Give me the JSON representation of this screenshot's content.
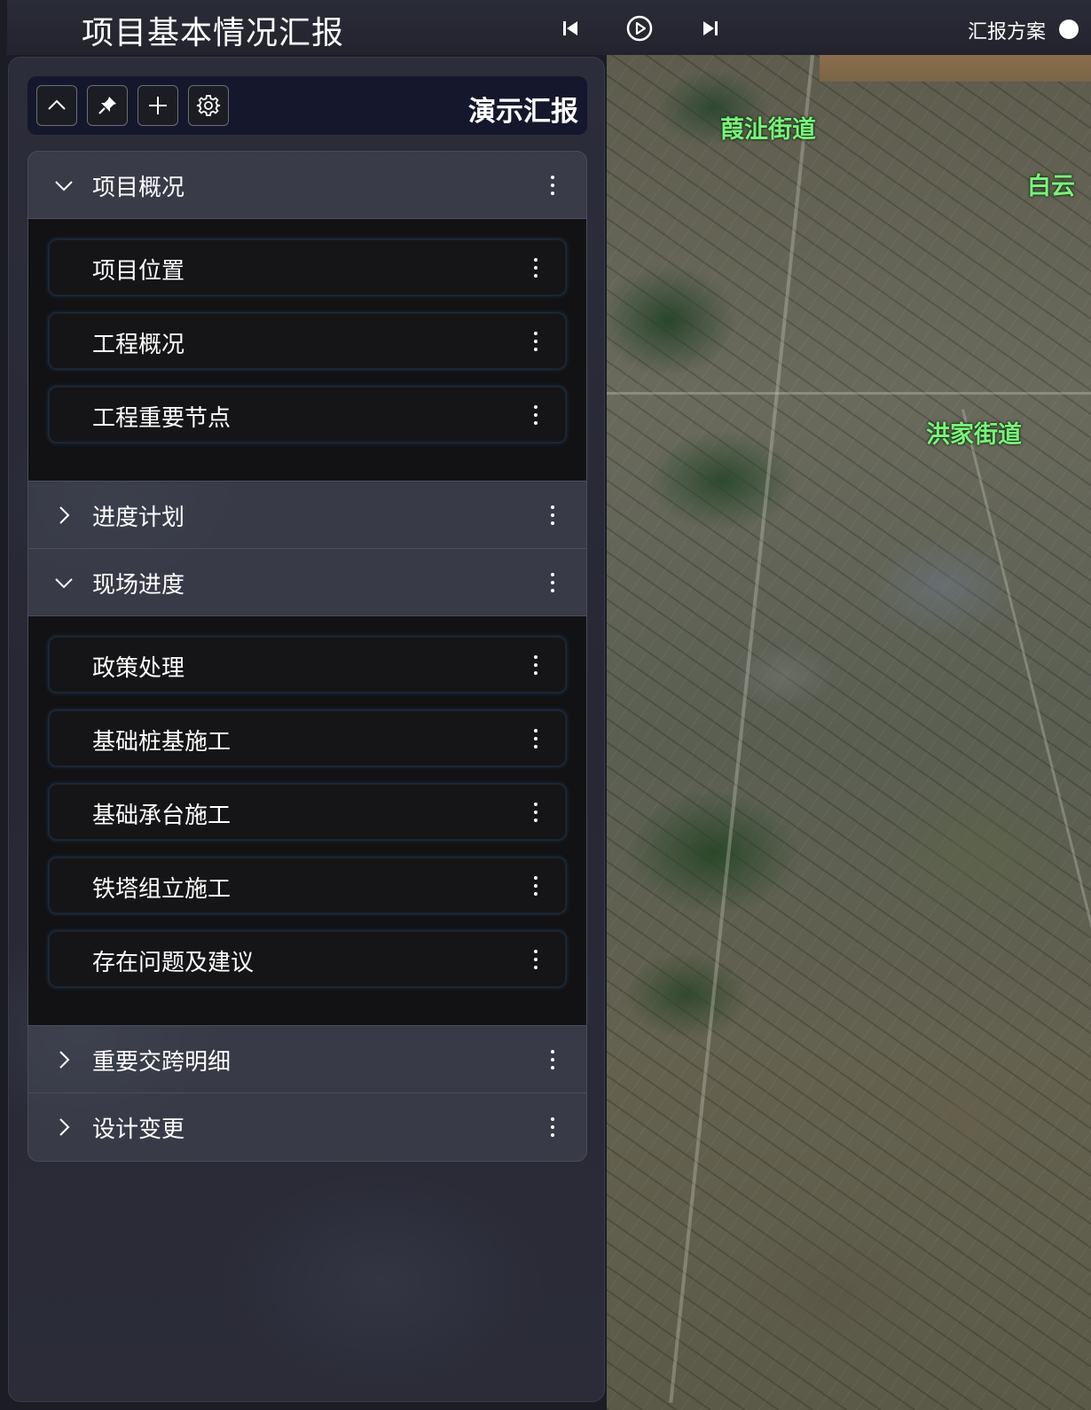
{
  "header": {
    "title": "项目基本情况汇报",
    "controls": [
      {
        "name": "skip-back-icon"
      },
      {
        "name": "play-circle-icon"
      },
      {
        "name": "skip-forward-icon"
      }
    ],
    "scheme_label": "汇报方案"
  },
  "toolbar": {
    "buttons": [
      {
        "name": "chevron-up-icon"
      },
      {
        "name": "pin-icon"
      },
      {
        "name": "plus-icon"
      },
      {
        "name": "gear-icon"
      }
    ],
    "title": "演示汇报"
  },
  "sections": [
    {
      "label": "项目概况",
      "expanded": true,
      "items": [
        "项目位置",
        "工程概况",
        "工程重要节点"
      ]
    },
    {
      "label": "进度计划",
      "expanded": false,
      "items": []
    },
    {
      "label": "现场进度",
      "expanded": true,
      "items": [
        "政策处理",
        "基础桩基施工",
        "基础承台施工",
        "铁塔组立施工",
        "存在问题及建议"
      ]
    },
    {
      "label": "重要交跨明细",
      "expanded": false,
      "items": []
    },
    {
      "label": "设计变更",
      "expanded": false,
      "items": []
    }
  ],
  "map": {
    "labels": [
      "葭沚街道",
      "白云",
      "洪家街道"
    ],
    "label_color": "#7df07d"
  },
  "colors": {
    "panel_bg": "#2a2b37",
    "toolbar_bg": "#15172c",
    "item_bg": "#151517",
    "item_glow": "#1e466e"
  }
}
